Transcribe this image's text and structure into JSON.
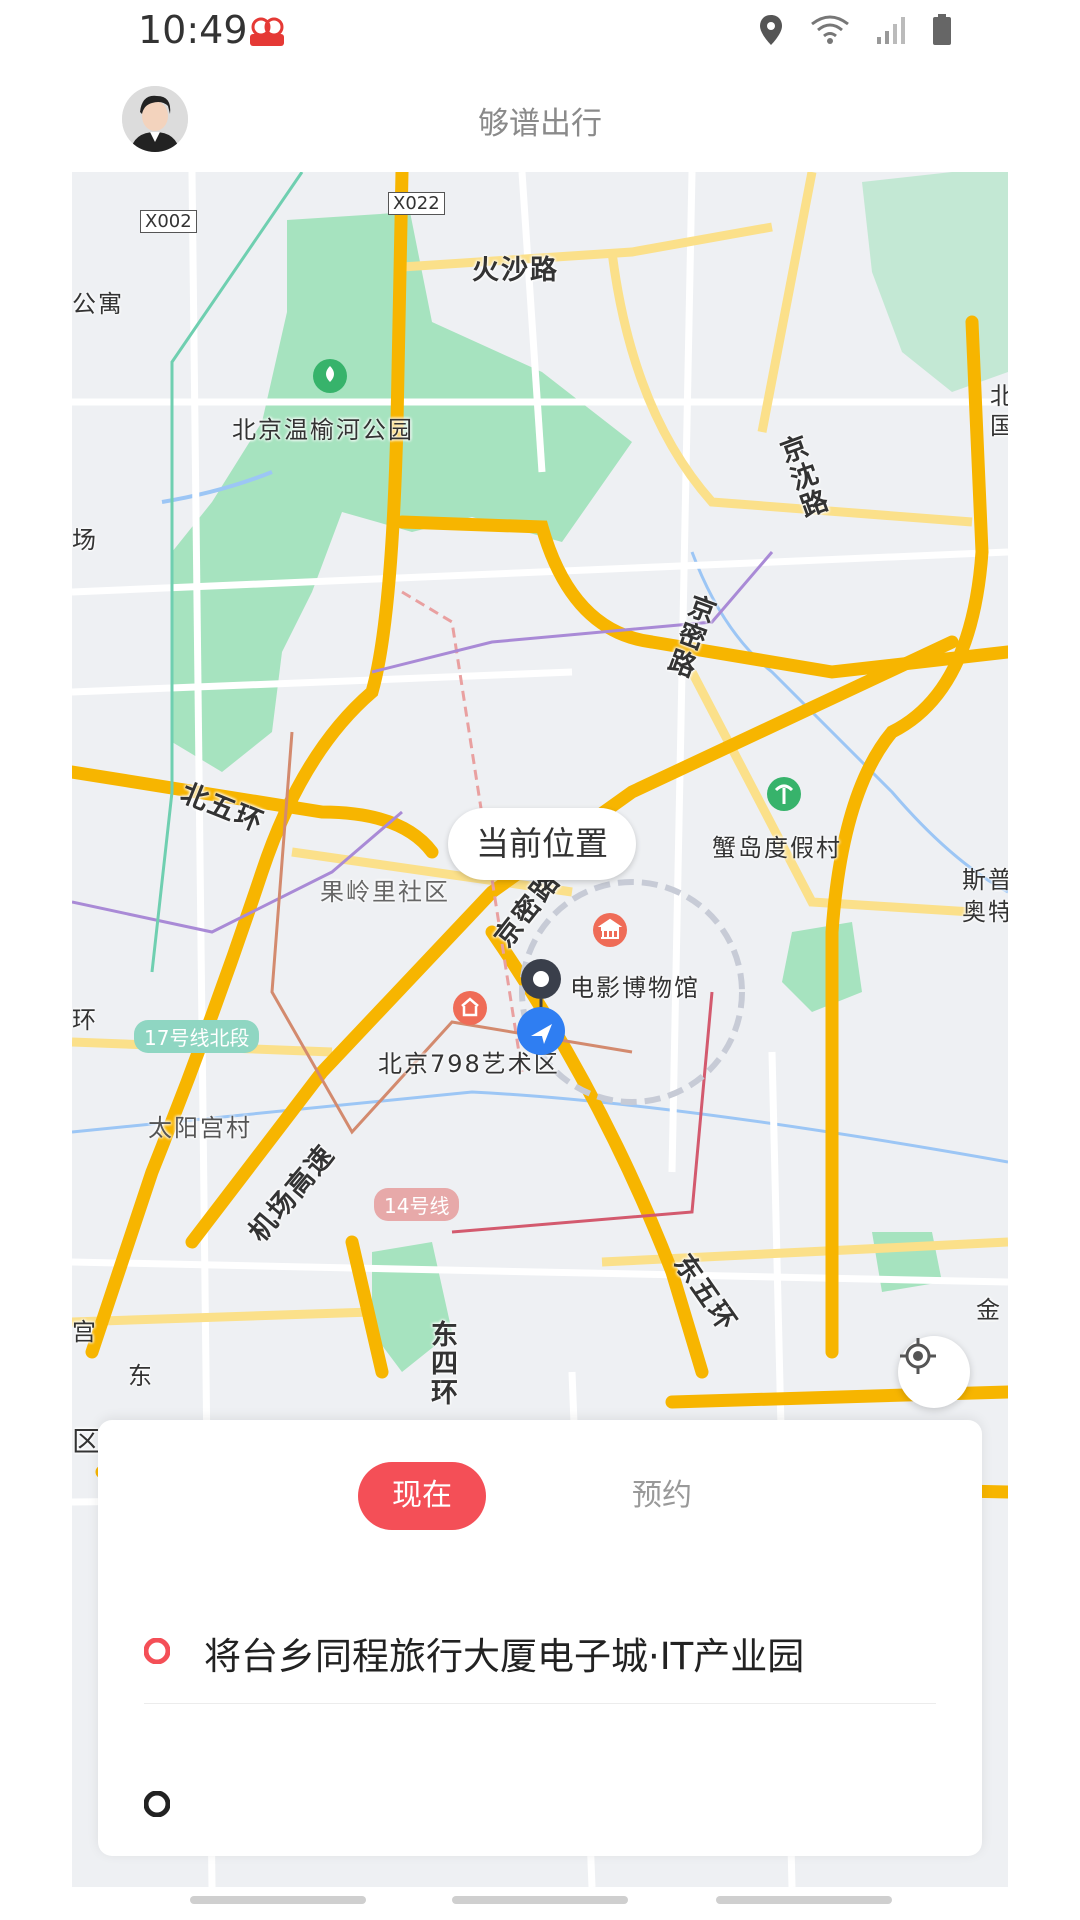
{
  "status_bar": {
    "time": "10:49",
    "icons": [
      "app-badge-icon",
      "location-icon",
      "wifi-icon",
      "signal-icon",
      "battery-icon"
    ]
  },
  "header": {
    "title": "够谱出行"
  },
  "map": {
    "current_location_label": "当前位置",
    "labels": {
      "x002": "X002",
      "x022": "X022",
      "huosha_road": "火沙路",
      "gongyu": "公寓",
      "wenyuhe_park": "北京温榆河公园",
      "chang": "场",
      "jingshen_road": "京沈路",
      "jingmi_road": "京密路",
      "north_5th_ring": "北五环",
      "xiedao_resort": "蟹岛度假村",
      "guolingli": "果岭里社区",
      "jingmi_road2": "京密路",
      "film_museum": "电影博物馆",
      "art_798": "北京798艺术区",
      "line17": "17号线北段",
      "taiyanggong": "太阳宫村",
      "airport_expressway": "机场高速",
      "line14": "14号线",
      "east_5th_ring": "东五环",
      "east_4th_ring": "东四环",
      "dong": "东",
      "gong": "宫",
      "huan": "环",
      "qu": "区",
      "sipu": "斯普",
      "aote": "奥特",
      "jin": "金",
      "bei": "北",
      "guo": "国"
    },
    "colors": {
      "highway": "#f7b500",
      "green": "#a6e3bf",
      "water": "#9cc6f5"
    }
  },
  "panel": {
    "tab_now": "现在",
    "tab_book": "预约",
    "pickup_location": "将台乡同程旅行大厦电子城·IT产业园",
    "destination_placeholder": ""
  },
  "colors": {
    "accent": "#f44f57",
    "pickup_dot": "#f44f57",
    "dest_dot": "#222222"
  }
}
